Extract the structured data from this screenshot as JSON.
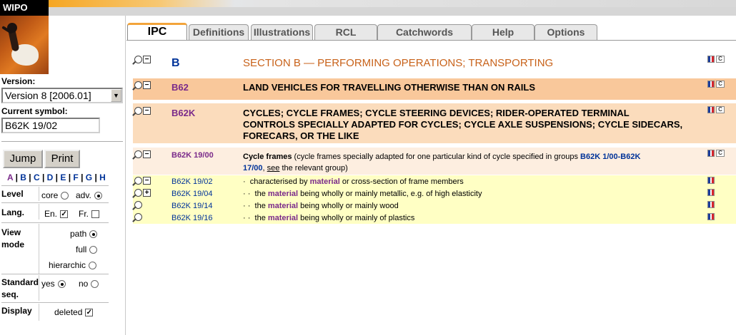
{
  "brand": "WIPO",
  "sidebar": {
    "version_label": "Version:",
    "version_value": "Version 8 [2006.01]",
    "symbol_label": "Current symbol:",
    "symbol_value": "B62K 19/02",
    "jump_label": "Jump",
    "print_label": "Print",
    "alphabet": [
      "A",
      "B",
      "C",
      "D",
      "E",
      "F",
      "G",
      "H"
    ],
    "level": {
      "label": "Level",
      "core": "core",
      "adv": "adv.",
      "selected": "adv."
    },
    "lang": {
      "label": "Lang.",
      "en": "En.",
      "fr": "Fr.",
      "en_checked": true,
      "fr_checked": false
    },
    "view_mode": {
      "label_1": "View",
      "label_2": "mode",
      "path": "path",
      "full": "full",
      "hierarchic": "hierarchic",
      "selected": "path"
    },
    "standard_seq": {
      "label_1": "Standard",
      "label_2": "seq.",
      "yes": "yes",
      "no": "no",
      "selected": "yes"
    },
    "display": {
      "label": "Display",
      "deleted": "deleted",
      "deleted_checked": true
    }
  },
  "tabs": [
    "IPC",
    "Definitions",
    "Illustrations",
    "RCL",
    "Catchwords",
    "Help",
    "Options"
  ],
  "active_tab": "IPC",
  "section": {
    "symbol": "B",
    "title": "SECTION B — PERFORMING OPERATIONS; TRANSPORTING"
  },
  "class": {
    "symbol": "B62",
    "title": "LAND VEHICLES FOR TRAVELLING OTHERWISE THAN ON RAILS"
  },
  "subclass": {
    "symbol": "B62K",
    "title_lines": [
      "CYCLES; CYCLE FRAMES; CYCLE STEERING DEVICES; RIDER-OPERATED TERMINAL",
      "CONTROLS SPECIALLY ADAPTED FOR CYCLES; CYCLE AXLE SUSPENSIONS; CYCLE SIDECARS,",
      "FORECARS, OR THE LIKE"
    ]
  },
  "main_group": {
    "symbol": "B62K 19/00",
    "title": "Cycle frames",
    "note_prefix": " (cycle frames specially adapted for one particular kind of cycle specified in groups ",
    "note_ref_1": "B62K 1/00-B62K",
    "note_ref_2": "17/00",
    "note_comma": ", ",
    "note_see": "see",
    "note_suffix": " the relevant group)"
  },
  "subgroups": [
    {
      "symbol": "B62K 19/02",
      "dots": "·",
      "pre": "characterised by ",
      "mat": "material",
      "post": " or cross-section of frame members"
    },
    {
      "symbol": "B62K 19/04",
      "dots": "· ·",
      "pre": "the ",
      "mat": "material",
      "post": " being wholly or mainly metallic, e.g. of high elasticity"
    },
    {
      "symbol": "B62K 19/14",
      "dots": "· ·",
      "pre": "the ",
      "mat": "material",
      "post": " being wholly or mainly wood"
    },
    {
      "symbol": "B62K 19/16",
      "dots": "· ·",
      "pre": "the ",
      "mat": "material",
      "post": " being wholly or mainly of plastics"
    }
  ],
  "colors": {
    "section_title": "#c8621a",
    "class_band": "#f9c89b",
    "subclass_band": "#fbdcbc",
    "group_band": "#fdeee0",
    "subgroup_band": "#ffffc4",
    "link_blue": "#003399",
    "material_purple": "#7a2a8a"
  }
}
